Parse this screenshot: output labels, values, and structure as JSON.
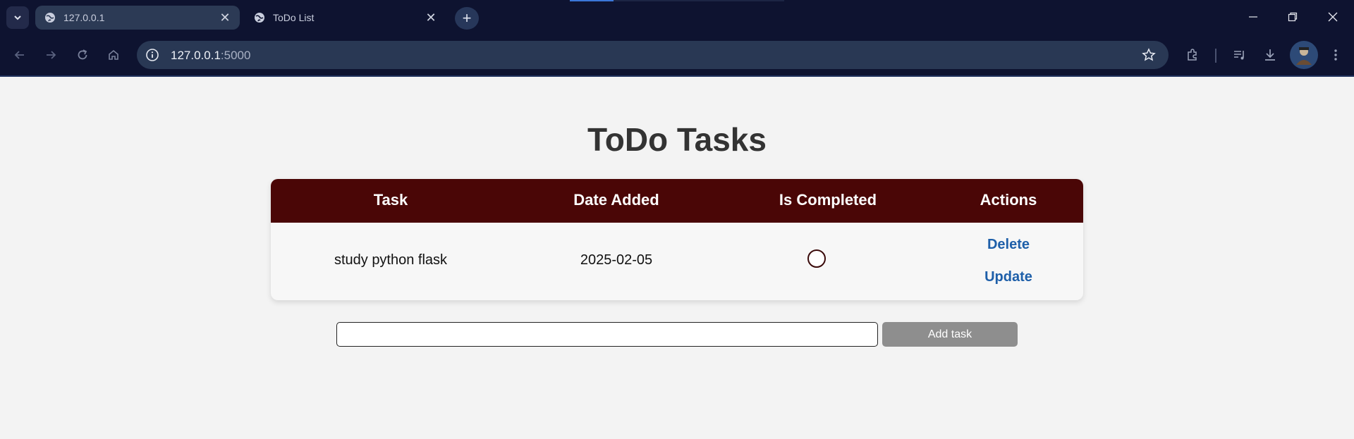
{
  "browser": {
    "tabs": [
      {
        "title": "127.0.0.1",
        "icon": "globe-icon",
        "active": false
      },
      {
        "title": "ToDo List",
        "icon": "globe-icon",
        "active": true
      }
    ],
    "address": {
      "host": "127.0.0.1",
      "port": ":5000"
    }
  },
  "page": {
    "title": "ToDo Tasks",
    "table": {
      "headers": [
        "Task",
        "Date Added",
        "Is Completed",
        "Actions"
      ],
      "rows": [
        {
          "task": "study python flask",
          "date_added": "2025-02-05",
          "is_completed": false,
          "actions": [
            "Delete",
            "Update"
          ]
        }
      ]
    },
    "form": {
      "input_value": "",
      "add_button_label": "Add task"
    }
  },
  "colors": {
    "header_bg": "#4a0606",
    "link": "#1e5fa9",
    "button_bg": "#8e8e8e",
    "page_bg": "#f3f3f3"
  }
}
